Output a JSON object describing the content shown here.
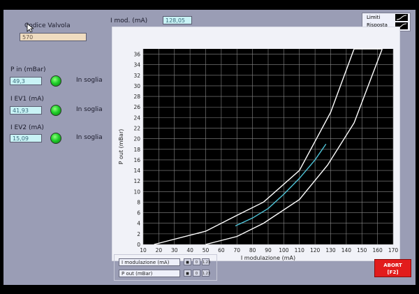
{
  "valve": {
    "label": "Codice Valvola",
    "value": "570"
  },
  "imod": {
    "label": "I mod. (mA)",
    "value": "128,05"
  },
  "readings": [
    {
      "label": "P in (mBar)",
      "value": "49,3",
      "status": "In soglia"
    },
    {
      "label": "I EV1 (mA)",
      "value": "41,93",
      "status": "In soglia"
    },
    {
      "label": "I EV2 (mA)",
      "value": "15,09",
      "status": "In soglia"
    }
  ],
  "legend": {
    "limits": "Limiti",
    "response": "Risposta"
  },
  "chart_data": {
    "type": "line",
    "xlabel": "I modulazione (mA)",
    "ylabel": "P out (mBar)",
    "xlim": [
      10,
      170
    ],
    "ylim": [
      0,
      37
    ],
    "xticks": [
      10,
      20,
      30,
      40,
      50,
      60,
      70,
      80,
      90,
      100,
      110,
      120,
      130,
      140,
      150,
      160,
      170
    ],
    "yticks": [
      0,
      2,
      4,
      6,
      8,
      10,
      12,
      14,
      16,
      18,
      20,
      22,
      24,
      26,
      28,
      30,
      32,
      34,
      36
    ],
    "grid": true,
    "series": [
      {
        "name": "Limiti",
        "color": "#ffffff",
        "x": [
          17,
          50,
          70,
          87,
          110,
          130,
          145,
          163,
          163
        ],
        "y": [
          0,
          2.5,
          5.5,
          8,
          14,
          25,
          37,
          37,
          37
        ]
      },
      {
        "name": "Limiti",
        "color": "#ffffff",
        "x": [
          50,
          70,
          87,
          110,
          128,
          145,
          163
        ],
        "y": [
          0,
          1.5,
          4,
          8.5,
          15,
          23,
          37
        ]
      },
      {
        "name": "Risposta",
        "color": "#4fc4d8",
        "x": [
          69,
          80,
          90,
          100,
          110,
          120,
          127
        ],
        "y": [
          3.5,
          5,
          6.8,
          9.5,
          12.5,
          16,
          19
        ]
      }
    ]
  },
  "bottom_panel": {
    "x_axis_label": "I modulazione (mA)",
    "y_axis_label": "P out (mBar)",
    "buttons": [
      "0",
      "1.23"
    ]
  },
  "abort": {
    "line1": "ABORT",
    "line2": "[F2]"
  }
}
